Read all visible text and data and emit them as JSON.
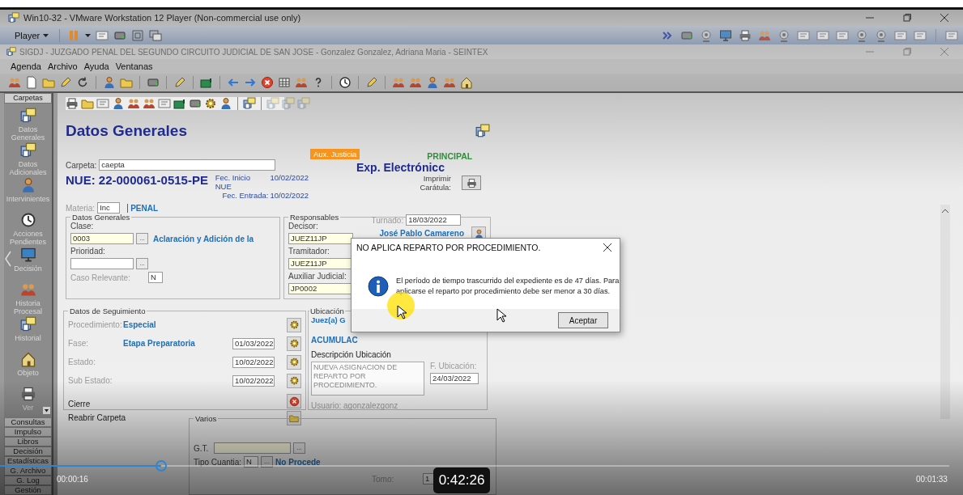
{
  "vm_window": {
    "title": "Win10-32 - VMware Workstation 12 Player (Non-commercial use only)",
    "player_menu": "Player"
  },
  "app_window": {
    "title": "SIGDJ - JUZGADO PENAL DEL SEGUNDO CIRCUITO JUDICIAL DE SAN JOSE - Gonzalez Gonzalez, Adriana Maria - SEINTEX"
  },
  "menu": [
    "Agenda",
    "Archivo",
    "Ayuda",
    "Ventanas"
  ],
  "sidebar": {
    "header": "Carpetas",
    "items": [
      {
        "label": "Datos Generales"
      },
      {
        "label": "Datos Adicionales"
      },
      {
        "label": "Intervinientes"
      },
      {
        "label": "Acciones Pendientes"
      },
      {
        "label": "Decisión"
      },
      {
        "label": "Historia Procesal"
      },
      {
        "label": "Historial"
      },
      {
        "label": "Objeto"
      },
      {
        "label": "Ver"
      }
    ],
    "buttons": [
      "Consultas",
      "Impulso",
      "Libros",
      "Decisión",
      "Estadísticas",
      "G. Archivo",
      "G. Log",
      "Gestión"
    ]
  },
  "form": {
    "heading": "Datos Generales",
    "badge": "Aux. Justicia",
    "principal": "PRINCIPAL",
    "expediente": "Exp. Electrónicc",
    "print_label": "Imprimir Carátula:",
    "carpeta": {
      "label": "Carpeta:",
      "value": "caepta"
    },
    "nue": "NUE: 22-000061-0515-PE",
    "dates": [
      {
        "label": "Fec. Inicio NUE",
        "value": "10/02/2022"
      },
      {
        "label": "Fec. Entrada:",
        "value": "10/02/2022"
      }
    ],
    "materia": {
      "label": "Materia:",
      "value": "Inc",
      "name": "PENAL"
    },
    "datos_generales": {
      "title": "Datos Generales",
      "clase": {
        "label": "Clase:",
        "value": "0003",
        "lookup": "...",
        "description": "Aclaración y Adición de la"
      },
      "prioridad": {
        "label": "Prioridad:",
        "lookup": "..."
      },
      "caso_relevante": {
        "label": "Caso Relevante:",
        "value": "N"
      }
    },
    "responsables": {
      "title": "Responsables",
      "decisor": {
        "label": "Decisor:",
        "value": "JUEZ11JP"
      },
      "turnado": {
        "label": "Turnado:",
        "value": "18/03/2022"
      },
      "judge": "José Pablo Camareno",
      "tramitador": {
        "label": "Tramitador:",
        "value": "JUEZ11JP"
      },
      "auxiliar": {
        "label": "Auxiliar Judicial:",
        "value": "JP0002"
      }
    },
    "seguimiento": {
      "title": "Datos de Seguimiento",
      "rows": [
        {
          "label": "Procedimiento:",
          "value": "Especial"
        },
        {
          "label": "Fase:",
          "value": "Etapa Preparatoria",
          "date": "01/03/2022"
        },
        {
          "label": "Estado:",
          "date": "10/02/2022"
        },
        {
          "label": "Sub Estado:",
          "date": "10/02/2022"
        }
      ],
      "cierre": "Cierre",
      "reabrir": "Reabrir Carpeta"
    },
    "ubicacion": {
      "title": "Ubicación",
      "office": "Juez(a) G",
      "status": "ACUMULAC",
      "desc_label": "Descripción Ubicación",
      "description": "NUEVA ASIGNACION DE REPARTO POR PROCEDIMIENTO.",
      "date_label": "F. Ubicación:",
      "date": "24/03/2022",
      "user": "Usuario: agonzalezgonz"
    },
    "varios": {
      "title": "Varios",
      "gt_label": "G.T.",
      "gt_lookup": "...",
      "tipo_label": "Tipo Cuantia:",
      "tipo_value": "N",
      "tipo_lookup": "...",
      "tipo_text": "No Procede",
      "tomo_label": "Tomo:",
      "tomo_value": "1"
    }
  },
  "dialog": {
    "title": "NO APLICA REPARTO POR PROCEDIMIENTO.",
    "message": "El período de tiempo trascurrido del expediente es de 47 días. Para aplicarse el reparto por procedimiento debe ser menor a 30 días.",
    "button": "Aceptar"
  },
  "player": {
    "elapsed": "00:00:16",
    "duration": "00:01:33",
    "hover_time": "0:42:26",
    "level": 0.17
  }
}
